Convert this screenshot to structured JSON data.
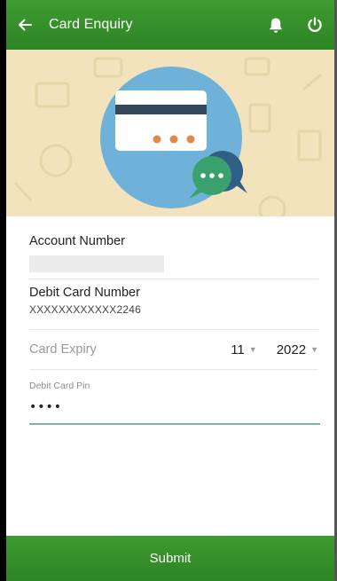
{
  "header": {
    "title": "Card Enquiry",
    "back_icon": "arrow-left-icon",
    "notification_icon": "bell-icon",
    "power_icon": "power-icon"
  },
  "hero": {
    "illustration": "credit-card-chat-illustration",
    "background_color": "#f2e3bd",
    "circle_color": "#6fb2d9"
  },
  "form": {
    "account_number_label": "Account Number",
    "account_number_value": "",
    "debit_card_label": "Debit Card Number",
    "debit_card_value": "XXXXXXXXXXXX2246",
    "card_expiry_label": "Card Expiry",
    "expiry_month": "11",
    "expiry_year": "2022",
    "pin_label": "Debit Card Pin",
    "pin_value": "••••"
  },
  "submit_label": "Submit",
  "colors": {
    "primary_green": "#2d8424",
    "input_underline": "#7fb79a"
  }
}
